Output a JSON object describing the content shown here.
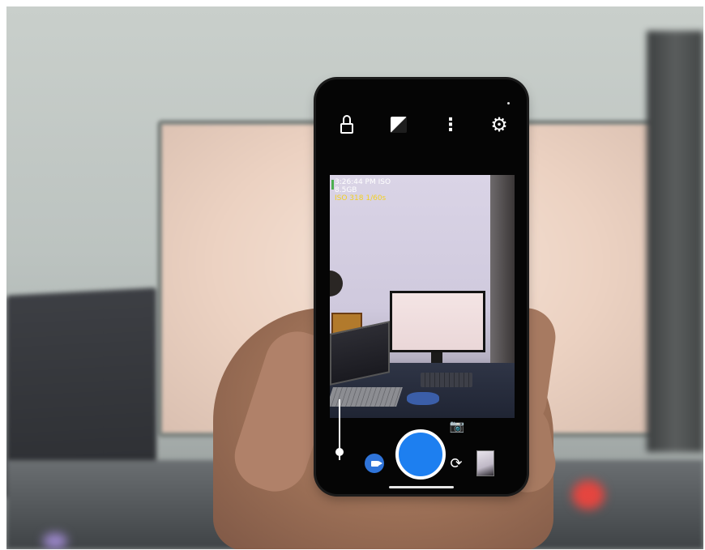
{
  "camera_app": {
    "top_icons": [
      "lock-icon",
      "exposure-icon",
      "more-options-icon",
      "settings-icon"
    ],
    "overlay": {
      "time": "3:26:44 PM",
      "iso_label": "ISO",
      "storage": "8.5GB",
      "exposure": "ISO 318  1/60s"
    },
    "bottom_controls": [
      "video-mode-icon",
      "shutter-button",
      "snapshot-icon",
      "switch-camera-icon",
      "gallery-thumbnail"
    ]
  },
  "colors": {
    "shutter": "#1d7ff0",
    "video_button": "#2f74d9",
    "overlay_highlight": "#f2d024"
  }
}
